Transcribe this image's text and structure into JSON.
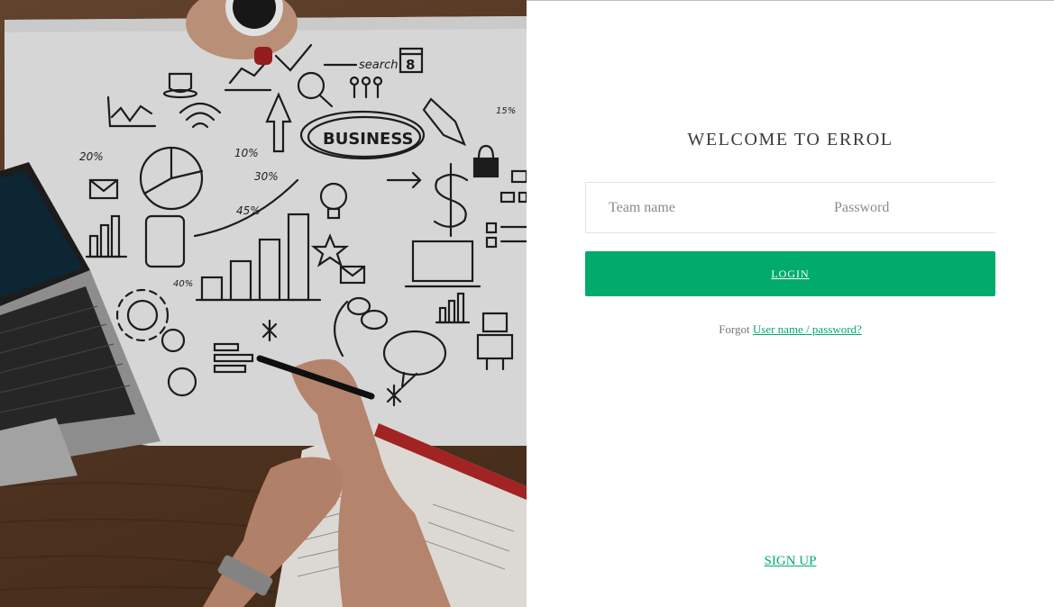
{
  "welcome": {
    "title": "WELCOME TO ERROL"
  },
  "form": {
    "team_placeholder": "Team name",
    "team_value": "",
    "password_placeholder": "Password",
    "password_value": "",
    "login_label": "LOGIN"
  },
  "forgot": {
    "prefix": "Forgot",
    "link": "User name / password?"
  },
  "signup": {
    "label": "SIGN UP"
  },
  "hero": {
    "sketch": {
      "business": "BUSINESS",
      "search": "search",
      "pct20": "20%",
      "pct10": "10%",
      "pct30": "30%",
      "pct45": "45%",
      "pct40": "40%",
      "pct15": "15%",
      "calendar": "8"
    }
  },
  "colors": {
    "accent": "#00ab6b",
    "title": "#3a3a3a"
  }
}
